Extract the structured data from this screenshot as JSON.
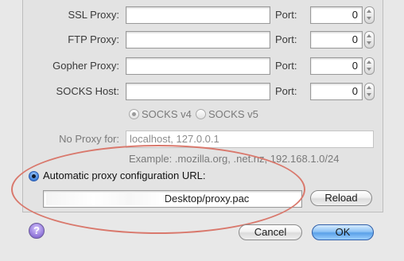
{
  "proxies": [
    {
      "label": "SSL Proxy:",
      "host": "",
      "port_label": "Port:",
      "port": "0"
    },
    {
      "label": "FTP Proxy:",
      "host": "",
      "port_label": "Port:",
      "port": "0"
    },
    {
      "label": "Gopher Proxy:",
      "host": "",
      "port_label": "Port:",
      "port": "0"
    },
    {
      "label": "SOCKS Host:",
      "host": "",
      "port_label": "Port:",
      "port": "0"
    }
  ],
  "socks": {
    "v4": "SOCKS v4",
    "v5": "SOCKS v5",
    "selected": "v4"
  },
  "no_proxy": {
    "label": "No Proxy for:",
    "value": "localhost, 127.0.0.1",
    "example": "Example: .mozilla.org, .net.nz, 192.168.1.0/24"
  },
  "auto_config": {
    "label": "Automatic proxy configuration URL:",
    "url": "/Desktop/proxy.pac",
    "reload": "Reload",
    "selected": true
  },
  "footer": {
    "help": "?",
    "cancel": "Cancel",
    "ok": "OK"
  },
  "colors": {
    "annotation": "#d9786c",
    "ok_button": "#5aa0e8",
    "help_button": "#8f74d8"
  }
}
